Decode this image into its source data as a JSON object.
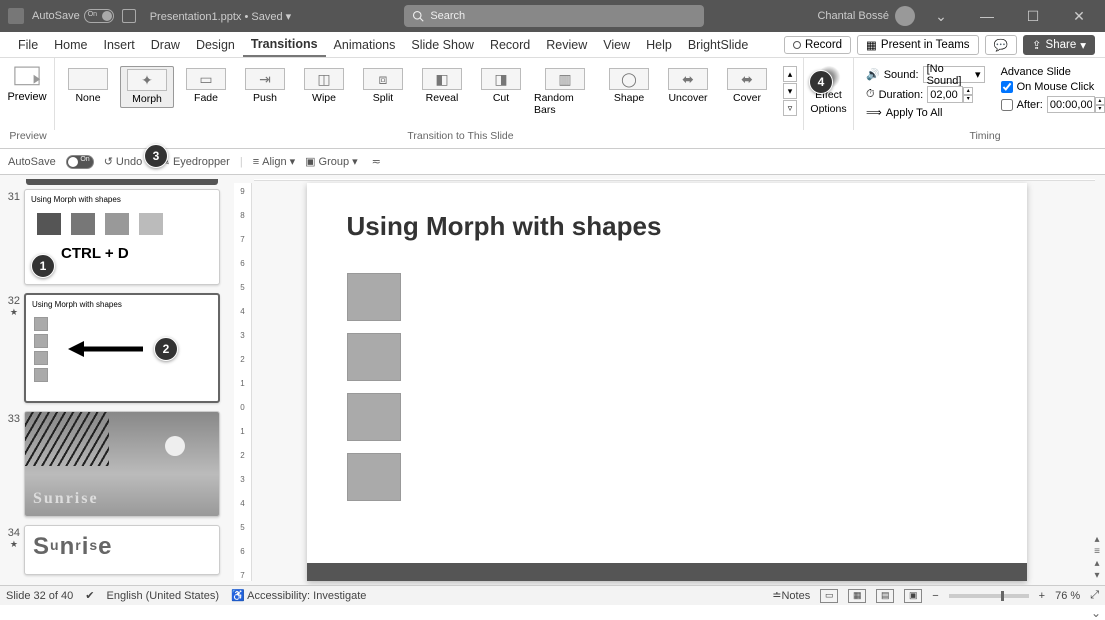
{
  "titlebar": {
    "autosave_label": "AutoSave",
    "autosave_state": "On",
    "doc_title": "Presentation1.pptx • Saved ▾",
    "search_placeholder": "Search",
    "user_name": "Chantal Bossé"
  },
  "menus": {
    "items": [
      "File",
      "Home",
      "Insert",
      "Draw",
      "Design",
      "Transitions",
      "Animations",
      "Slide Show",
      "Record",
      "Review",
      "View",
      "Help",
      "BrightSlide"
    ],
    "active": "Transitions",
    "record_btn": "Record",
    "present_btn": "Present in Teams",
    "share_btn": "Share"
  },
  "ribbon": {
    "preview_label": "Preview",
    "transitions": [
      "None",
      "Morph",
      "Fade",
      "Push",
      "Wipe",
      "Split",
      "Reveal",
      "Cut",
      "Random Bars",
      "Shape",
      "Uncover",
      "Cover"
    ],
    "selected_transition": "Morph",
    "effect_label_top": "Effect",
    "effect_label_bottom": "Options",
    "sound_label": "Sound:",
    "sound_value": "[No Sound]",
    "duration_label": "Duration:",
    "duration_value": "02,00",
    "apply_all": "Apply To All",
    "advance_label": "Advance Slide",
    "on_click_label": "On Mouse Click",
    "after_label": "After:",
    "after_value": "00:00,00",
    "group_preview": "Preview",
    "group_transition": "Transition to This Slide",
    "group_timing": "Timing"
  },
  "qat": {
    "autosave": "AutoSave",
    "autosave_state": "On",
    "undo": "Undo",
    "eyedropper": "Eyedropper",
    "align": "Align",
    "group": "Group"
  },
  "thumbs": {
    "t31": {
      "num": "31",
      "title": "Using Morph with shapes",
      "ctrl": "CTRL + D"
    },
    "t32": {
      "num": "32",
      "title": "Using Morph with shapes"
    },
    "t33": {
      "num": "33",
      "text": "Sunrise"
    },
    "t34": {
      "num": "34",
      "text": "Sunrise"
    }
  },
  "callouts": {
    "c1": "1",
    "c2": "2",
    "c3": "3",
    "c4": "4"
  },
  "slide": {
    "title": "Using Morph with shapes"
  },
  "status": {
    "slide_info": "Slide 32 of 40",
    "language": "English (United States)",
    "accessibility": "Accessibility: Investigate",
    "notes": "Notes",
    "zoom": "76 %"
  }
}
